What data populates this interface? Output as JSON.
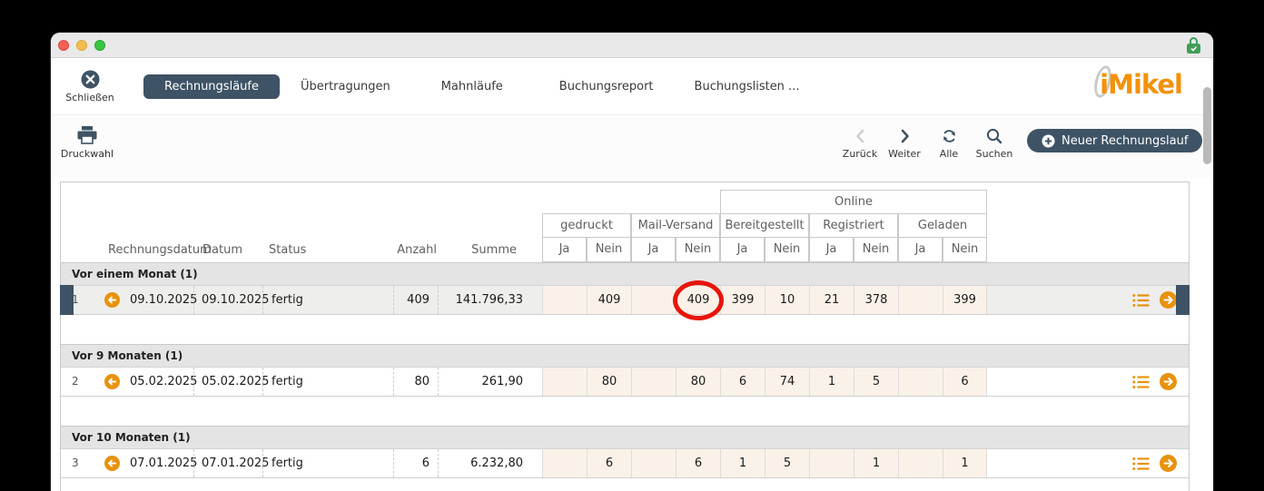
{
  "window": {
    "app_logo": "iMikel"
  },
  "titlebar": {
    "icons": [
      "close-traffic-light",
      "minimize-traffic-light",
      "zoom-traffic-light",
      "lock-check-icon"
    ]
  },
  "tabs": {
    "close_label": "Schließen",
    "items": [
      {
        "label": "Rechnungsläufe",
        "active": true
      },
      {
        "label": "Übertragungen",
        "active": false
      },
      {
        "label": "Mahnläufe",
        "active": false
      },
      {
        "label": "Buchungsreport",
        "active": false
      },
      {
        "label": "Buchungslisten ...",
        "active": false
      }
    ]
  },
  "toolbar": {
    "druckwahl_label": "Druckwahl",
    "zurueck_label": "Zurück",
    "weiter_label": "Weiter",
    "alle_label": "Alle",
    "suchen_label": "Suchen",
    "new_run_label": "Neuer Rechnungslauf"
  },
  "table": {
    "headers": {
      "rechnungsdatum": "Rechnungsdatum",
      "datum": "Datum",
      "status": "Status",
      "anzahl": "Anzahl",
      "summe": "Summe",
      "gedruckt": "gedruckt",
      "mail_versand": "Mail-Versand",
      "online": "Online",
      "bereitgestellt": "Bereitgestellt",
      "registriert": "Registriert",
      "geladen": "Geladen",
      "ja": "Ja",
      "nein": "Nein"
    },
    "groups": [
      {
        "label": "Vor einem Monat (1)",
        "rows": [
          {
            "num": "1",
            "rechnungsdatum": "09.10.2025",
            "datum": "09.10.2025",
            "status": "fertig",
            "anzahl": "409",
            "summe": "141.796,33",
            "cells": [
              "",
              "409",
              "",
              "409",
              "399",
              "10",
              "21",
              "378",
              "",
              "399"
            ],
            "selected": true,
            "annotated_cell_index": 3
          }
        ]
      },
      {
        "label": "Vor 9 Monaten (1)",
        "rows": [
          {
            "num": "2",
            "rechnungsdatum": "05.02.2025",
            "datum": "05.02.2025",
            "status": "fertig",
            "anzahl": "80",
            "summe": "261,90",
            "cells": [
              "",
              "80",
              "",
              "80",
              "6",
              "74",
              "1",
              "5",
              "",
              "6"
            ],
            "selected": false,
            "annotated_cell_index": null
          }
        ]
      },
      {
        "label": "Vor 10 Monaten (1)",
        "rows": [
          {
            "num": "3",
            "rechnungsdatum": "07.01.2025",
            "datum": "07.01.2025",
            "status": "fertig",
            "anzahl": "6",
            "summe": "6.232,80",
            "cells": [
              "",
              "6",
              "",
              "6",
              "1",
              "5",
              "",
              "1",
              "",
              "1"
            ],
            "selected": false,
            "annotated_cell_index": null
          }
        ]
      }
    ],
    "cell_columns": [
      "gedruckt-ja",
      "gedruckt-nein",
      "mail-versand-ja",
      "mail-versand-nein",
      "bereitgestellt-ja",
      "bereitgestellt-nein",
      "registriert-ja",
      "registriert-nein",
      "geladen-ja",
      "geladen-nein"
    ]
  },
  "annotation": {
    "type": "red-ellipse",
    "color": "#e8150b",
    "note": "hand-drawn red circle around the Mail-Versand 'Nein' value 409 in row 1"
  },
  "colors": {
    "accent_slate": "#3e5365",
    "brand_orange": "#f39109",
    "icon_orange": "#e8920e",
    "cell_cream": "#faf2e9",
    "group_row_gray": "#e4e4e4",
    "annotation_red": "#e8150b",
    "lock_green": "#3f9e57"
  }
}
